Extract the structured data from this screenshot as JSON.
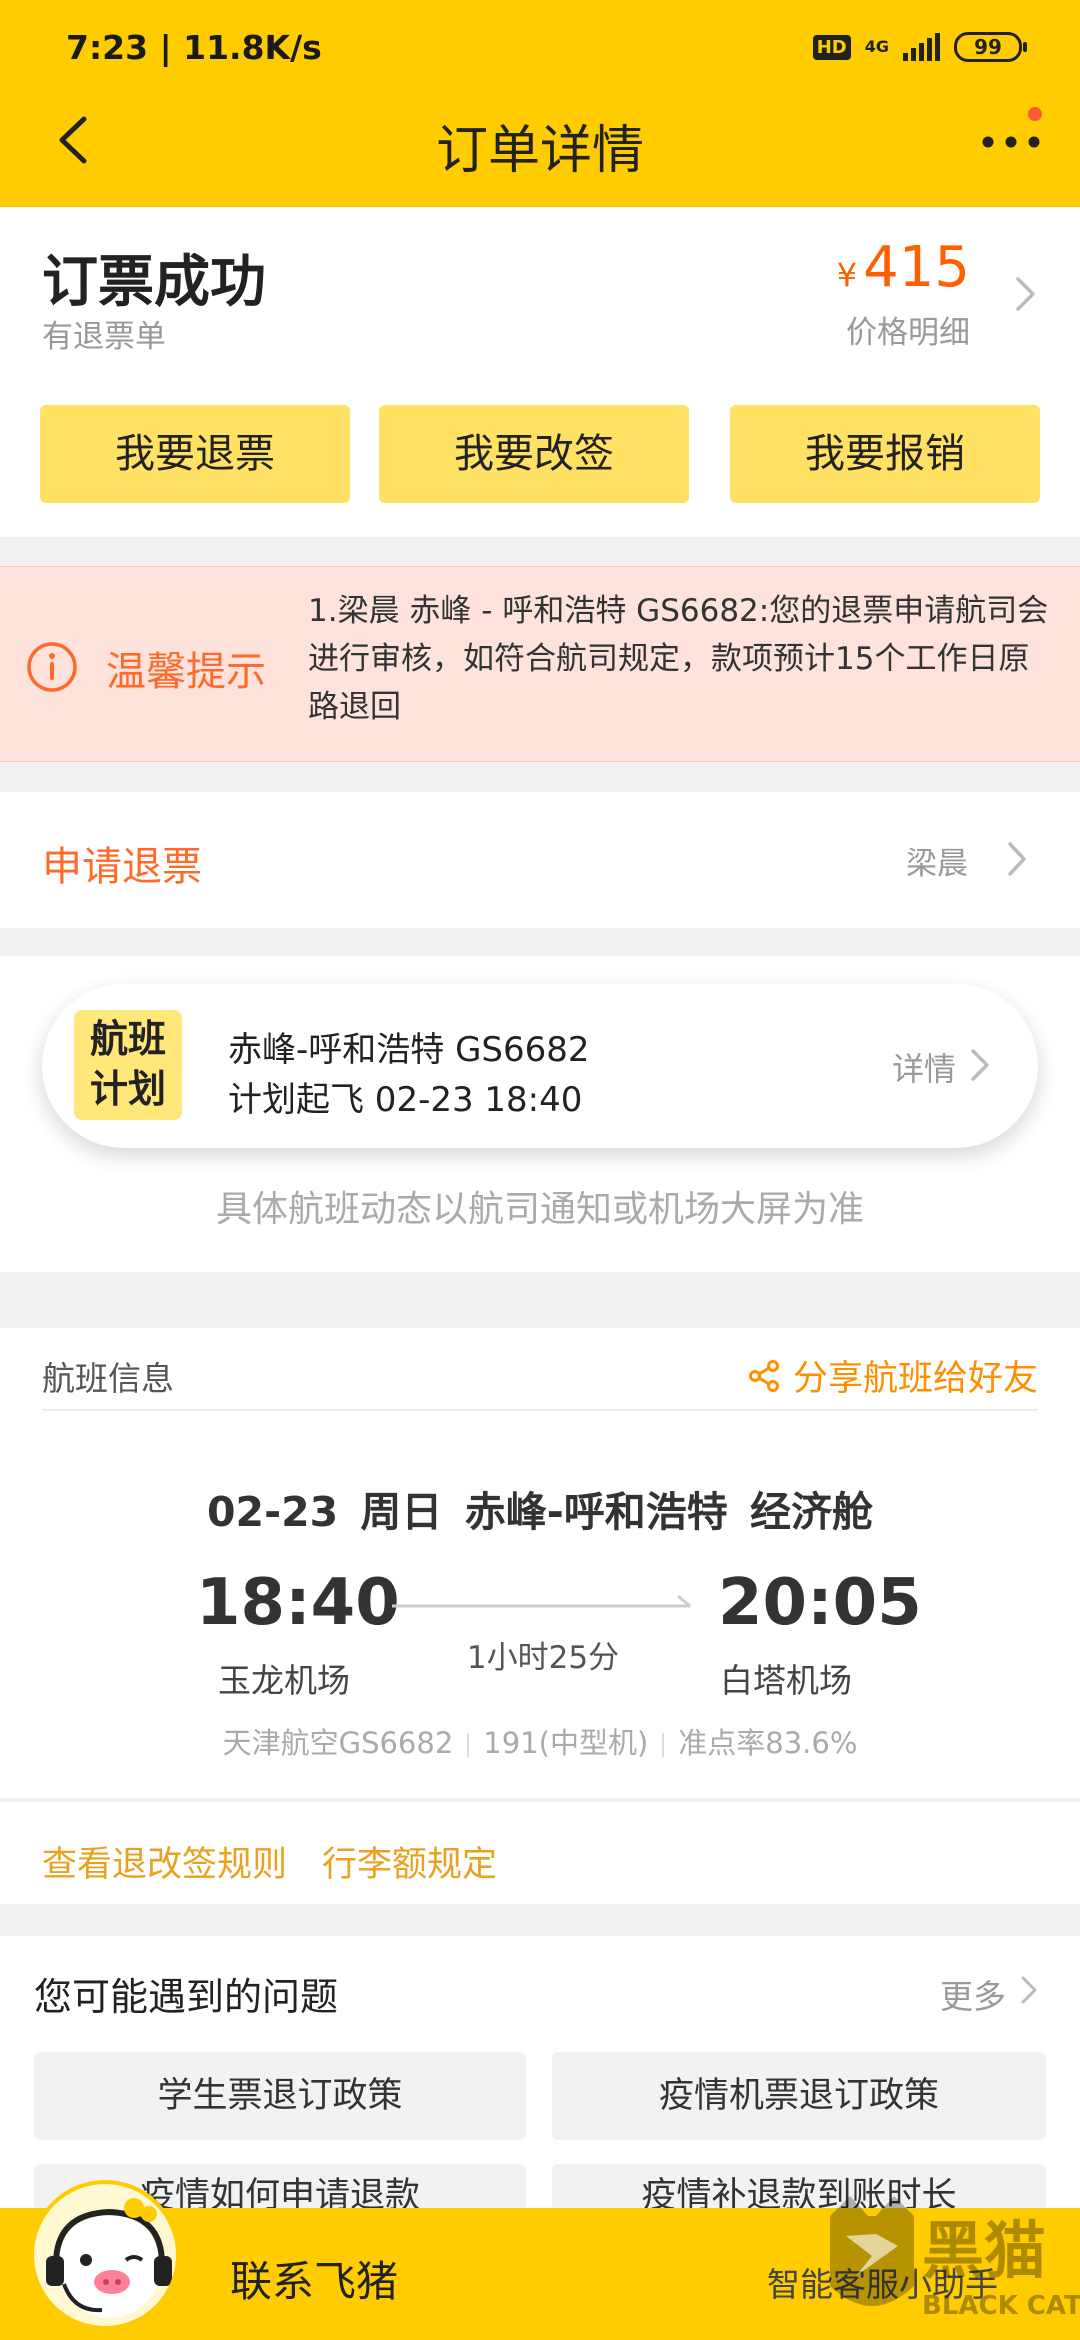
{
  "status_bar": {
    "time": "7:23 | 11.8K/s",
    "hd": "HD",
    "network": "4G",
    "battery": "99"
  },
  "header": {
    "title": "订单详情"
  },
  "order": {
    "status": "订票成功",
    "refund_note": "有退票单",
    "currency": "¥",
    "price": "415",
    "price_detail": "价格明细"
  },
  "actions": {
    "refund": "我要退票",
    "change": "我要改签",
    "reimburse": "我要报销"
  },
  "notice": {
    "title": "温馨提示",
    "text": "1.梁晨 赤峰 - 呼和浩特 GS6682:您的退票申请航司会进行审核，如符合航司规定，款项预计15个工作日原路退回"
  },
  "refund_row": {
    "title": "申请退票",
    "passenger": "梁晨"
  },
  "flight_plan": {
    "tag_line1": "航班",
    "tag_line2": "计划",
    "route": "赤峰-呼和浩特 GS6682",
    "planned": "计划起飞 02-23 18:40",
    "detail": "详情",
    "note": "具体航班动态以航司通知或机场大屏为准"
  },
  "flight_info": {
    "title": "航班信息",
    "share": "分享航班给好友",
    "date_line": "02-23 周日 赤峰-呼和浩特 经济舱",
    "dep_time": "18:40",
    "arr_time": "20:05",
    "duration": "1小时25分",
    "dep_airport": "玉龙机场",
    "arr_airport": "白塔机场",
    "airline": "天津航空GS6682",
    "aircraft": "191(中型机)",
    "punctuality": "准点率83.6%"
  },
  "rules": {
    "change_rules": "查看退改签规则",
    "baggage": "行李额规定"
  },
  "faq": {
    "title": "您可能遇到的问题",
    "more": "更多",
    "items": [
      "学生票退订政策",
      "疫情机票退订政策",
      "疫情如何申请退款",
      "疫情补退款到账时长"
    ]
  },
  "bottom": {
    "contact": "联系飞猪",
    "assistant": "智能客服小助手",
    "watermark_cn": "黑猫",
    "watermark_en": "BLACK CAT"
  },
  "colors": {
    "brand_yellow": "#ffcc00",
    "button_yellow": "#ffe164",
    "accent_orange": "#ff6a2b",
    "price_orange": "#ff5f00",
    "notice_bg": "#fde3db"
  }
}
